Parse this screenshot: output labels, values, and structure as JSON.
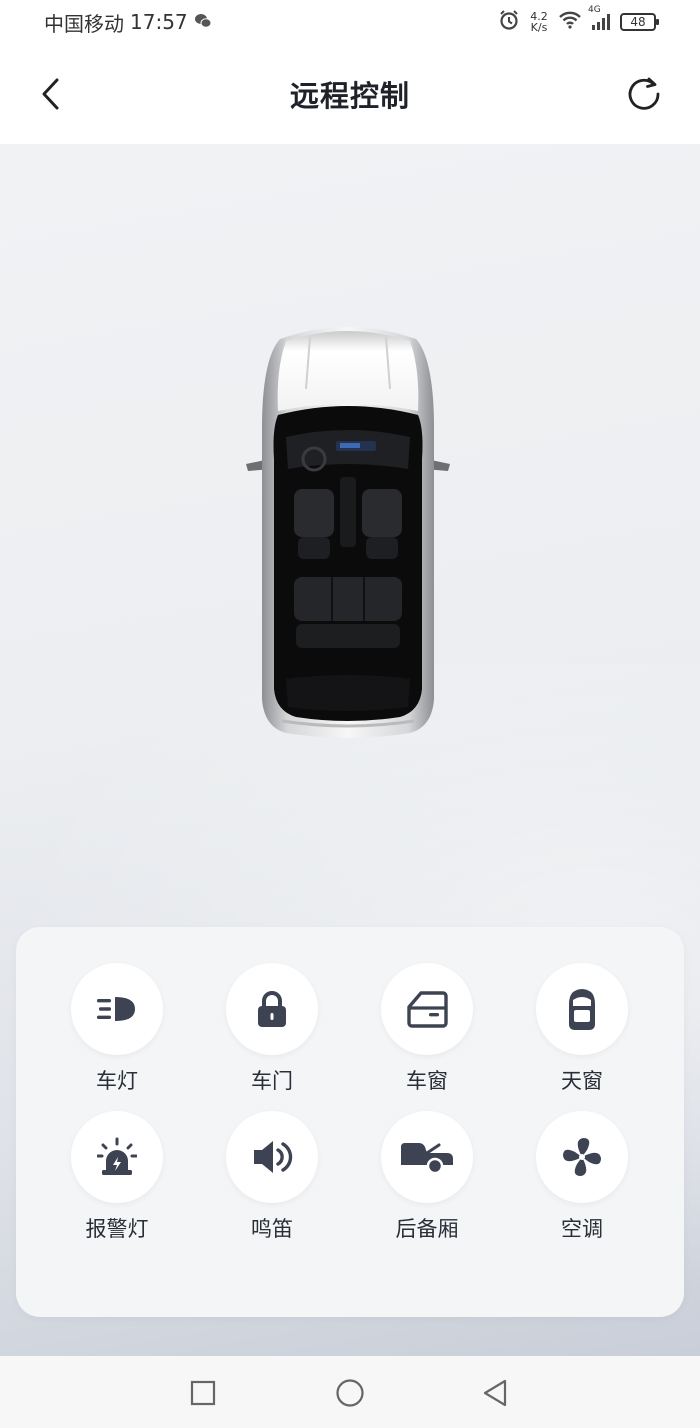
{
  "status": {
    "carrier": "中国移动",
    "time": "17:57",
    "speed_value": "4.2",
    "speed_unit": "K/s",
    "network": "4G",
    "battery": "48"
  },
  "header": {
    "title": "远程控制"
  },
  "controls": [
    {
      "label": "车灯",
      "icon": "headlight-icon"
    },
    {
      "label": "车门",
      "icon": "lock-icon"
    },
    {
      "label": "车窗",
      "icon": "car-window-icon"
    },
    {
      "label": "天窗",
      "icon": "sunroof-icon"
    },
    {
      "label": "报警灯",
      "icon": "alarm-light-icon"
    },
    {
      "label": "鸣笛",
      "icon": "horn-icon"
    },
    {
      "label": "后备厢",
      "icon": "trunk-icon"
    },
    {
      "label": "空调",
      "icon": "fan-icon"
    }
  ],
  "colors": {
    "icon": "#3d4352",
    "panel": "#f4f5f7",
    "background": "#eceef1"
  }
}
